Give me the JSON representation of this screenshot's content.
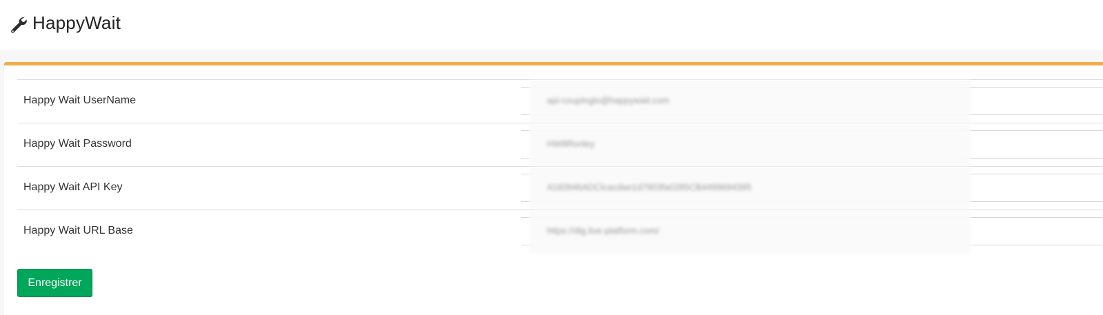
{
  "header": {
    "title": "HappyWait",
    "icon": "wrench-icon"
  },
  "panel": {
    "accent_color": "#f0ad4e"
  },
  "form": {
    "fields": [
      {
        "label": "Happy Wait UserName",
        "value": "api-coupinglo@happywait.com"
      },
      {
        "label": "Happy Wait Password",
        "value": "HW8Ronley"
      },
      {
        "label": "Happy Wait API Key",
        "value": "4160946ADClcacdae1d7903fa0285CB4499694395"
      },
      {
        "label": "Happy Wait URL Base",
        "value": "https://dig.live-platform.com/"
      }
    ],
    "save_label": "Enregistrer",
    "save_color": "#00a65a"
  }
}
